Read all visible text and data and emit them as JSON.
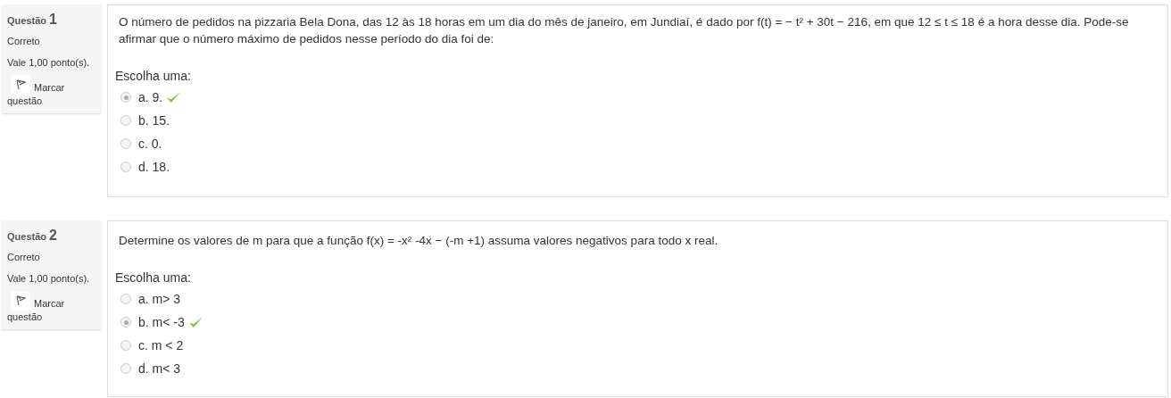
{
  "questions": [
    {
      "label": "Questão",
      "number": "1",
      "status": "Correto",
      "points": "Vale 1,00 ponto(s).",
      "flag": "Marcar questão",
      "text": "O número de pedidos na pizzaria Bela Dona, das 12 às 18 horas em um dia do mês de janeiro, em Jundiaí, é dado por f(t) = − t² + 30t − 216, em que 12 ≤ t ≤ 18 é a hora desse dia. Pode-se afirmar que o número máximo de pedidos nesse período do dia foi de:",
      "prompt": "Escolha uma:",
      "options": [
        {
          "text": "a. 9.",
          "selected": true,
          "correct": true
        },
        {
          "text": "b. 15.",
          "selected": false,
          "correct": false
        },
        {
          "text": "c. 0.",
          "selected": false,
          "correct": false
        },
        {
          "text": "d. 18.",
          "selected": false,
          "correct": false
        }
      ]
    },
    {
      "label": "Questão",
      "number": "2",
      "status": "Correto",
      "points": "Vale 1,00 ponto(s).",
      "flag": "Marcar questão",
      "text": "Determine os valores de m para que a função f(x) = -x² -4x − (-m +1) assuma valores negativos para todo x real.",
      "prompt": "Escolha uma:",
      "options": [
        {
          "text": "a. m> 3",
          "selected": false,
          "correct": false
        },
        {
          "text": "b. m< -3",
          "selected": true,
          "correct": true
        },
        {
          "text": "c. m < 2",
          "selected": false,
          "correct": false
        },
        {
          "text": "d. m< 3",
          "selected": false,
          "correct": false
        }
      ]
    }
  ]
}
